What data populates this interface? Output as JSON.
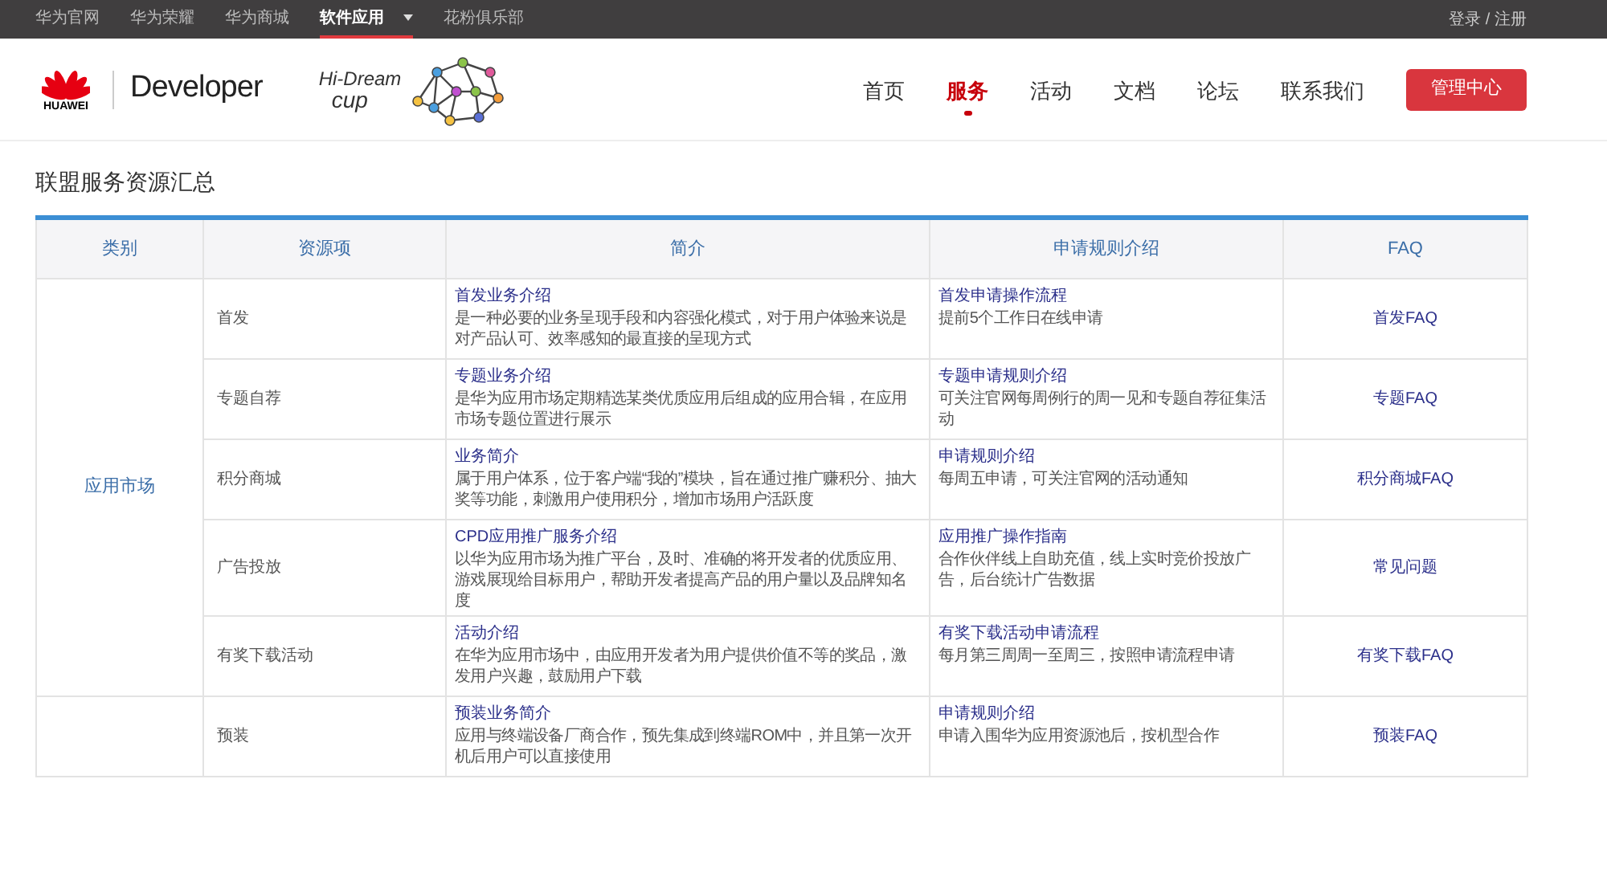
{
  "top_bar": {
    "links": [
      {
        "label": "华为官网",
        "selected": false
      },
      {
        "label": "华为荣耀",
        "selected": false
      },
      {
        "label": "华为商城",
        "selected": false
      },
      {
        "label": "软件应用",
        "selected": true,
        "dropdown": true
      },
      {
        "label": "花粉俱乐部",
        "selected": false
      }
    ],
    "account": "登录 / 注册"
  },
  "header": {
    "brand": "HUAWEI",
    "product": "Developer",
    "event_logo": {
      "line1": "Hi-Dream",
      "line2": "cup"
    },
    "nav": [
      {
        "label": "首页",
        "selected": false
      },
      {
        "label": "服务",
        "selected": true
      },
      {
        "label": "活动",
        "selected": false
      },
      {
        "label": "文档",
        "selected": false
      },
      {
        "label": "论坛",
        "selected": false
      },
      {
        "label": "联系我们",
        "selected": false
      }
    ],
    "button": "管理中心"
  },
  "page_title": "联盟服务资源汇总",
  "table": {
    "columns": [
      "类别",
      "资源项",
      "简介",
      "申请规则介绍",
      "FAQ"
    ],
    "groups": [
      {
        "category": "应用市场",
        "rows": [
          {
            "item": "首发",
            "intro_link": "首发业务介绍",
            "intro": "是一种必要的业务呈现手段和内容强化模式，对于用户体验来说是对产品认可、效率感知的最直接的呈现方式",
            "rule_link": "首发申请操作流程",
            "rule": "提前5个工作日在线申请",
            "faq": "首发FAQ"
          },
          {
            "item": "专题自荐",
            "intro_link": "专题业务介绍",
            "intro": "是华为应用市场定期精选某类优质应用后组成的应用合辑，在应用市场专题位置进行展示",
            "rule_link": "专题申请规则介绍",
            "rule": "可关注官网每周例行的周一见和专题自荐征集活动",
            "faq": "专题FAQ"
          },
          {
            "item": "积分商城",
            "intro_link": "业务简介",
            "intro": "属于用户体系，位于客户端“我的”模块，旨在通过推广赚积分、抽大奖等功能，刺激用户使用积分，增加市场用户活跃度",
            "rule_link": "申请规则介绍",
            "rule": "每周五申请，可关注官网的活动通知",
            "faq": "积分商城FAQ"
          },
          {
            "item": "广告投放",
            "intro_link": "CPD应用推广服务介绍",
            "intro": "以华为应用市场为推广平台，及时、准确的将开发者的优质应用、游戏展现给目标用户，帮助开发者提高产品的用户量以及品牌知名度",
            "rule_link": "应用推广操作指南",
            "rule": "合作伙伴线上自助充值，线上实时竞价投放广告，后台统计广告数据",
            "faq": "常见问题"
          },
          {
            "item": "有奖下载活动",
            "intro_link": "活动介绍",
            "intro": "在华为应用市场中，由应用开发者为用户提供价值不等的奖品，激发用户兴趣，鼓励用户下载",
            "rule_link": "有奖下载活动申请流程",
            "rule": "每月第三周周一至周三，按照申请流程申请",
            "faq": "有奖下载FAQ"
          }
        ]
      },
      {
        "rows": [
          {
            "item": "预装",
            "intro_link": "预装业务简介",
            "intro": "应用与终端设备厂商合作，预先集成到终端ROM中，并且第一次开机后用户可以直接使用",
            "rule_link": "申请规则介绍",
            "rule": "申请入围华为应用资源池后，按机型合作",
            "faq": "预装FAQ"
          }
        ]
      }
    ]
  }
}
